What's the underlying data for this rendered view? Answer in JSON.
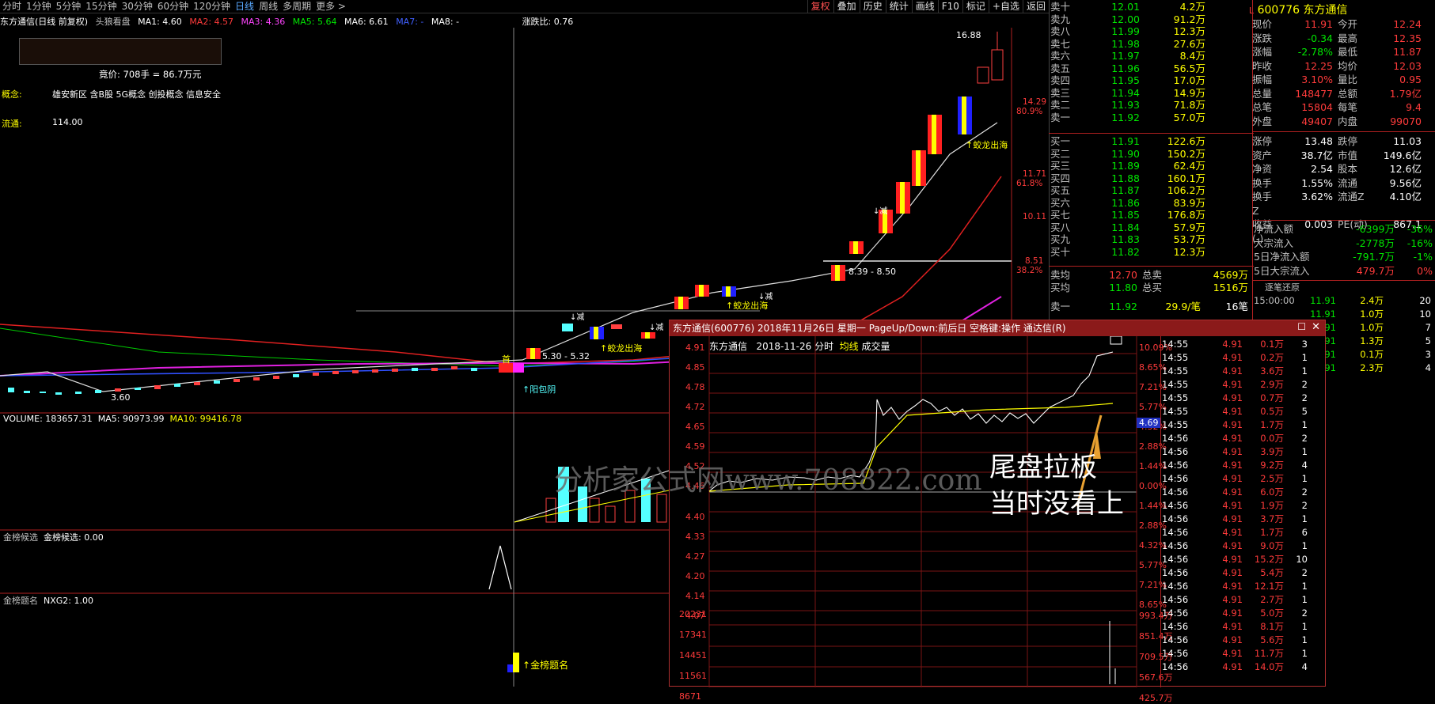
{
  "topbar": {
    "periods": [
      "分时",
      "1分钟",
      "5分钟",
      "15分钟",
      "30分钟",
      "60分钟",
      "120分钟",
      "日线",
      "周线",
      "多周期",
      "更多 >"
    ],
    "active": "日线",
    "tools": [
      "复权",
      "叠加",
      "历史",
      "统计",
      "画线",
      "F10",
      "标记",
      "+自选",
      "返回"
    ]
  },
  "title_line": {
    "name": "东方通信(日线 前复权)",
    "indicator": "头狼看盘",
    "ma1": "MA1: 4.60",
    "ma2": "MA2: 4.57",
    "ma3": "MA3: 4.36",
    "ma5": "MA5: 5.64",
    "ma6": "MA6: 6.61",
    "ma7": "MA7: -",
    "ma8": "MA8: -",
    "zdb": "涨跌比: 0.76"
  },
  "left_info": {
    "bid": "竟价: 708手 = 86.7万元",
    "concept_label": "概念:",
    "concepts": "雄安新区 含B股 5G概念 创投概念 信息安全",
    "float_label": "流通:",
    "float_val": "114.00"
  },
  "kline": {
    "high_label": "16.88",
    "low_label": "3.60",
    "range1": "5.30 - 5.32",
    "range2": "8.39 - 8.50",
    "signals": [
      "阳包阴",
      "蛟龙出海",
      "蛟龙出海",
      "蛟龙出海",
      "减",
      "减",
      "减",
      "减",
      "首"
    ],
    "right_prices": [
      "14.29",
      "80.9%",
      "11.71",
      "61.8%",
      "10.11",
      "8.51",
      "38.2%"
    ]
  },
  "volume": {
    "label": "VOLUME: 183657.31",
    "ma5": "MA5: 90973.99",
    "ma10": "MA10: 99416.78"
  },
  "panel3": {
    "label": "金榜候选",
    "value": "金榜候选: 0.00"
  },
  "panel4": {
    "label": "金榜题名",
    "value": "NXG2: 1.00",
    "signal": "金榜题名"
  },
  "watermark": "分析家公式网www.708822.com",
  "annotation": "尾盘拉板\n当时没看上",
  "annotation1": "尾盘拉板",
  "annotation2": "当时没看上",
  "quote": {
    "code": "600776",
    "name": "东方通信",
    "sell": [
      [
        "卖十",
        "12.01",
        "4.2万"
      ],
      [
        "卖九",
        "12.00",
        "91.2万"
      ],
      [
        "卖八",
        "11.99",
        "12.3万"
      ],
      [
        "卖七",
        "11.98",
        "27.6万"
      ],
      [
        "卖六",
        "11.97",
        "8.4万"
      ],
      [
        "卖五",
        "11.96",
        "56.5万"
      ],
      [
        "卖四",
        "11.95",
        "17.0万"
      ],
      [
        "卖三",
        "11.94",
        "14.9万"
      ],
      [
        "卖二",
        "11.93",
        "71.8万"
      ],
      [
        "卖一",
        "11.92",
        "57.0万"
      ]
    ],
    "buy": [
      [
        "买一",
        "11.91",
        "122.6万"
      ],
      [
        "买二",
        "11.90",
        "150.2万"
      ],
      [
        "买三",
        "11.89",
        "62.4万"
      ],
      [
        "买四",
        "11.88",
        "160.1万"
      ],
      [
        "买五",
        "11.87",
        "106.2万"
      ],
      [
        "买六",
        "11.86",
        "83.9万"
      ],
      [
        "买七",
        "11.85",
        "176.8万"
      ],
      [
        "买八",
        "11.84",
        "57.9万"
      ],
      [
        "买九",
        "11.83",
        "53.7万"
      ],
      [
        "买十",
        "11.82",
        "12.3万"
      ]
    ],
    "avg_sell": [
      "卖均",
      "12.70",
      "总卖",
      "4569万"
    ],
    "avg_buy": [
      "买均",
      "11.80",
      "总买",
      "1516万"
    ],
    "last_trade": [
      "卖一",
      "11.92",
      "29.9/笔",
      "16笔"
    ],
    "stats": [
      [
        "现价",
        "11.91",
        "今开",
        "12.24"
      ],
      [
        "涨跌",
        "-0.34",
        "最高",
        "12.35"
      ],
      [
        "涨幅",
        "-2.78%",
        "最低",
        "11.87"
      ],
      [
        "昨收",
        "12.25",
        "均价",
        "12.03"
      ],
      [
        "振幅",
        "3.10%",
        "量比",
        "0.95"
      ],
      [
        "总量",
        "148477",
        "总额",
        "1.79亿"
      ],
      [
        "总笔",
        "15804",
        "每笔",
        "9.4"
      ],
      [
        "外盘",
        "49407",
        "内盘",
        "99070"
      ]
    ],
    "stats2": [
      [
        "涨停",
        "13.48",
        "跌停",
        "11.03"
      ],
      [
        "资产",
        "38.7亿",
        "市值",
        "149.6亿"
      ],
      [
        "净资",
        "2.54",
        "股本",
        "12.6亿"
      ],
      [
        "换手",
        "1.55%",
        "流通",
        "9.56亿"
      ],
      [
        "换手Z",
        "3.62%",
        "流通Z",
        "4.10亿"
      ],
      [
        "收益(-)",
        "0.003",
        "PE(动)",
        "867.1"
      ]
    ],
    "flows": [
      [
        "净流入额",
        "-6399万",
        "-36%"
      ],
      [
        "大宗流入",
        "-2778万",
        "-16%"
      ],
      [
        "5日净流入额",
        "-791.7万",
        "-1%"
      ],
      [
        "5日大宗流入",
        "479.7万",
        "0%"
      ]
    ],
    "ticks_label": "逐笔还原",
    "ticks": [
      [
        "15:00:00",
        "11.91",
        "2.4万",
        "20"
      ],
      [
        "",
        "11.91",
        "1.0万",
        "10"
      ],
      [
        "",
        "11.91",
        "1.0万",
        "7"
      ],
      [
        "",
        "11.91",
        "1.3万",
        "5"
      ],
      [
        "",
        "11.91",
        "0.1万",
        "3"
      ],
      [
        "",
        "11.91",
        "2.3万",
        "4"
      ]
    ]
  },
  "popup": {
    "title": "东方通信(600776) 2018年11月26日 星期一 PageUp/Down:前后日 空格键:操作 通达信(R)",
    "sub_name": "东方通信",
    "sub_date": "2018-11-26 分时",
    "sub_avg": "均线",
    "sub_vol": "成交量",
    "left_prices": [
      "4.91",
      "4.85",
      "4.78",
      "4.72",
      "4.65",
      "4.59",
      "4.52",
      "4.46",
      "4.40",
      "4.33",
      "4.27",
      "4.20",
      "4.14",
      "4.07"
    ],
    "right_pcts": [
      "10.09%",
      "8.65%",
      "7.21%",
      "5.77%",
      "4.32%",
      "2.88%",
      "1.44%",
      "0.00%",
      "1.44%",
      "2.88%",
      "4.32%",
      "5.77%",
      "7.21%",
      "8.65%"
    ],
    "vol_left": [
      "20231",
      "17341",
      "14451",
      "11561",
      "8671"
    ],
    "vol_right": [
      "993.4万",
      "851.4万",
      "709.5万",
      "567.6万",
      "425.7万"
    ],
    "cur": "4.69",
    "ticks": [
      [
        "14:55",
        "4.91",
        "0.1万"
      ],
      [
        "14:55",
        "4.91",
        "0.2万"
      ],
      [
        "14:55",
        "4.91",
        "3.6万"
      ],
      [
        "14:55",
        "4.91",
        "2.9万"
      ],
      [
        "14:55",
        "4.91",
        "0.7万"
      ],
      [
        "14:55",
        "4.91",
        "0.5万"
      ],
      [
        "14:55",
        "4.91",
        "1.7万"
      ],
      [
        "14:56",
        "4.91",
        "0.0万"
      ],
      [
        "14:56",
        "4.91",
        "3.9万"
      ],
      [
        "14:56",
        "4.91",
        "9.2万"
      ],
      [
        "14:56",
        "4.91",
        "2.5万"
      ],
      [
        "14:56",
        "4.91",
        "6.0万"
      ],
      [
        "14:56",
        "4.91",
        "1.9万"
      ],
      [
        "14:56",
        "4.91",
        "3.7万"
      ],
      [
        "14:56",
        "4.91",
        "1.7万"
      ],
      [
        "14:56",
        "4.91",
        "9.0万"
      ],
      [
        "14:56",
        "4.91",
        "15.2万"
      ],
      [
        "14:56",
        "4.91",
        "5.4万"
      ],
      [
        "14:56",
        "4.91",
        "12.1万"
      ],
      [
        "14:56",
        "4.91",
        "2.7万"
      ],
      [
        "14:56",
        "4.91",
        "5.0万"
      ],
      [
        "14:56",
        "4.91",
        "8.1万"
      ],
      [
        "14:56",
        "4.91",
        "5.6万"
      ],
      [
        "14:56",
        "4.91",
        "11.7万"
      ],
      [
        "14:56",
        "4.91",
        "14.0万"
      ]
    ],
    "tick_counts": [
      "3",
      "1",
      "1",
      "2",
      "2",
      "5",
      "1",
      "2",
      "1",
      "4",
      "1",
      "2",
      "2",
      "1",
      "6",
      "1",
      "10",
      "2",
      "1",
      "1",
      "2",
      "1",
      "1",
      "1",
      "4"
    ]
  }
}
